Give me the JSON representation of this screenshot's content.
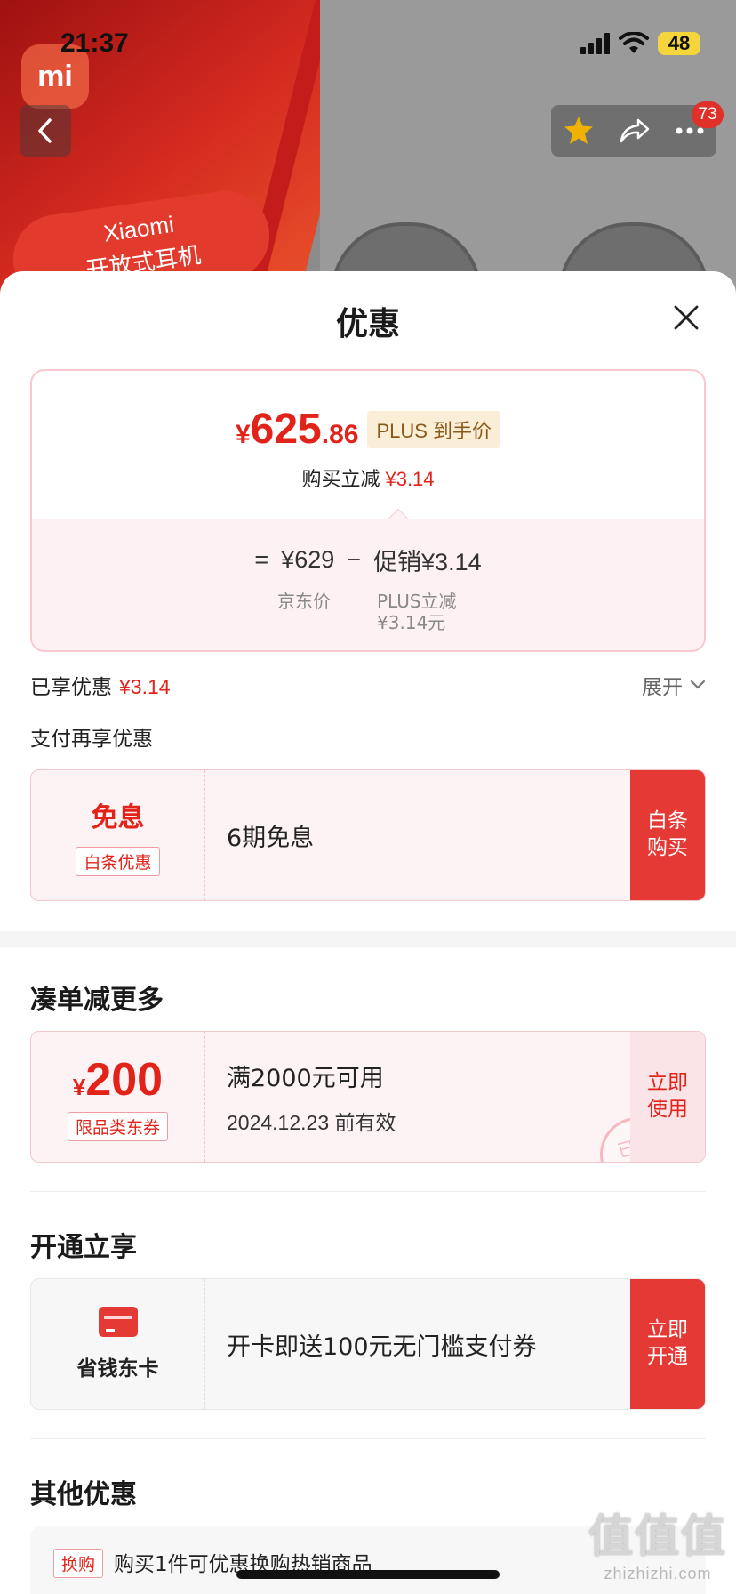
{
  "status_bar": {
    "time": "21:37",
    "battery": "48"
  },
  "background": {
    "logo": "mi",
    "badge_line1": "Xiaomi",
    "badge_line2": "开放式耳机",
    "cart_count": "73"
  },
  "sheet": {
    "title": "优惠",
    "price": {
      "symbol": "¥",
      "integer": "625",
      "decimal": ".86",
      "tag": "PLUS 到手价",
      "buy_reduce_label": "购买立减",
      "buy_reduce_value": "¥3.14",
      "equals": "=",
      "jd_price": "¥629",
      "minus": "−",
      "promo": "促销¥3.14",
      "jd_price_label": "京东价",
      "plus_reduce_label": "PLUS立减",
      "plus_reduce_value": "¥3.14元"
    },
    "enjoyed_label": "已享优惠",
    "enjoyed_value": "¥3.14",
    "expand_label": "展开",
    "pay_more_label": "支付再享优惠",
    "baitiao": {
      "title": "免息",
      "tag": "白条优惠",
      "main": "6期免息",
      "button": "白条\n购买"
    },
    "section_more": "凑单减更多",
    "coupon": {
      "symbol": "¥",
      "amount": "200",
      "tag": "限品类东券",
      "main": "满2000元可用",
      "sub": "2024.12.23 前有效",
      "button": "立即\n使用",
      "stamp": "已领"
    },
    "section_open": "开通立享",
    "card": {
      "label": "省钱东卡",
      "main": "开卡即送100元无门槛支付券",
      "button": "立即\n开通"
    },
    "section_other": "其他优惠",
    "other": {
      "tag": "换购",
      "text": "购买1件可优惠换购热销商品"
    }
  },
  "watermark": {
    "big": "值值值",
    "small": "zhizhizhi.com"
  },
  "colors": {
    "accent": "#e2231a",
    "button_red": "#e53935",
    "plus_tag_bg": "#fbeed6"
  }
}
